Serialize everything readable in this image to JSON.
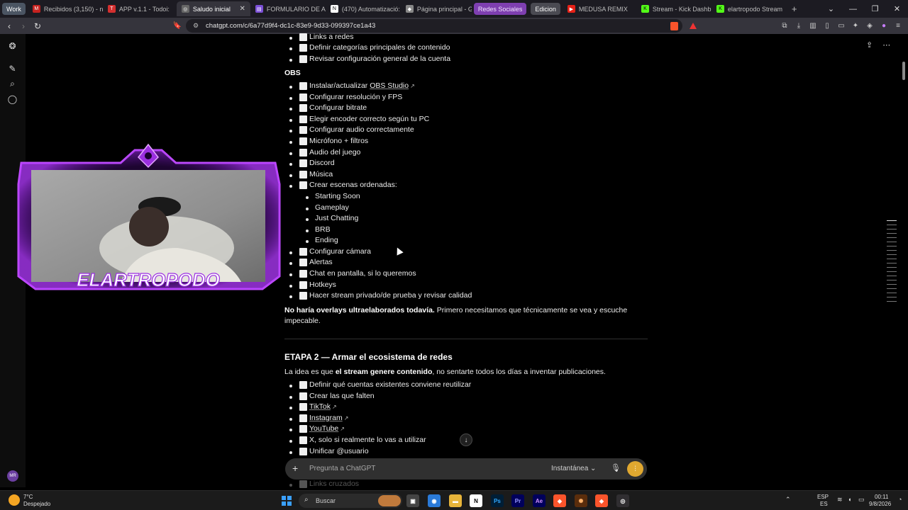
{
  "tabs": {
    "group_work": "Work",
    "items": [
      {
        "label": "Recibidos (3,150) - n",
        "color": "#c5221f",
        "glyph": "M"
      },
      {
        "label": "APP v.1.1 - Todoi:",
        "color": "#d32f2f",
        "glyph": "T"
      },
      {
        "label": "Saludo inicial",
        "color": "#555",
        "glyph": "◎"
      },
      {
        "label": "FORMULARIO DE AI",
        "color": "#7b4fd6",
        "glyph": "▤"
      },
      {
        "label": "(470) Automatizació:",
        "color": "#111",
        "glyph": "N"
      },
      {
        "label": "Página principal - Gi",
        "color": "#888",
        "glyph": "◆"
      }
    ],
    "group_redes": "Redes Sociales",
    "group_edicion": "Edicion",
    "items_after": [
      {
        "label": "MEDUSA REMIX",
        "color": "#e62117",
        "glyph": "▶"
      },
      {
        "label": "Stream - Kick Dashb",
        "color": "#53fc18",
        "glyph": "K"
      },
      {
        "label": "elartropodo Stream",
        "color": "#53fc18",
        "glyph": "K"
      }
    ],
    "new_tab": "+"
  },
  "address": {
    "url": "chatgpt.com/c/6a77d9f4-dc1c-83e9-9d33-099397ce1a43"
  },
  "overlay_logo": "ELARTROPODO",
  "content": {
    "top_items": [
      "Links a redes",
      "Definir categorías principales de contenido",
      "Revisar configuración general de la cuenta"
    ],
    "obs_heading": "OBS",
    "obs_items": [
      "Instalar/actualizar ",
      "Configurar resolución y FPS",
      "Configurar bitrate",
      "Elegir encoder correcto según tu PC",
      "Configurar audio correctamente",
      "Micrófono + filtros",
      "Audio del juego",
      "Discord",
      "Música",
      "Crear escenas ordenadas:"
    ],
    "obs_link": "OBS Studio",
    "scenes": [
      "Starting Soon",
      "Gameplay",
      "Just Chatting",
      "BRB",
      "Ending"
    ],
    "obs_items_after": [
      "Configurar cámara",
      "Alertas",
      "Chat en pantalla, si lo queremos",
      "Hotkeys",
      "Hacer stream privado/de prueba y revisar calidad"
    ],
    "note_bold": "No haría overlays ultraelaborados todavía.",
    "note_rest": " Primero necesitamos que técnicamente se vea y escuche",
    "note_line2": "impecable.",
    "stage2_title": "ETAPA 2 — Armar el ecosistema de redes",
    "stage2_intro_a": "La idea es que ",
    "stage2_intro_b": "el stream genere contenido",
    "stage2_intro_c": ", no sentarte todos los días a inventar publicaciones.",
    "stage2_items": [
      "Definir qué cuentas existentes conviene reutilizar",
      "Crear las que falten"
    ],
    "stage2_links": [
      "TikTok",
      "Instagram",
      "YouTube"
    ],
    "stage2_items_after": [
      "X, solo si realmente lo vas a utilizar",
      "Unificar @usuario"
    ],
    "faded_item": "Links cruzados"
  },
  "composer": {
    "placeholder": "Pregunta a ChatGPT",
    "model": "Instantánea"
  },
  "taskbar": {
    "weather_temp": "7°C",
    "weather_desc": "Despejado",
    "search": "Buscar",
    "lang1": "ESP",
    "lang2": "ES",
    "time": "00:11",
    "date": "9/8/2026"
  },
  "sidebar": {
    "avatar": "MR"
  }
}
